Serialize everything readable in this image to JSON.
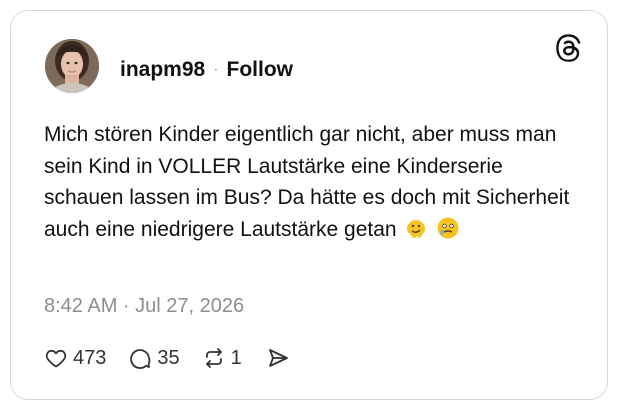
{
  "post": {
    "username": "inapm98",
    "separator": "·",
    "follow_label": "Follow",
    "text": "Mich stören Kinder eigentlich gar nicht, aber muss man sein Kind in VOLLER Lautstärke eine Kinderserie schauen lassen im Bus? Da hätte es doch mit Sicherheit auch eine niedrigere Lautstärke getan",
    "emojis": [
      "melting-face-emoji",
      "face-holding-back-tears-emoji"
    ],
    "timestamp": "8:42 AM · Jul 27, 2026",
    "likes": "473",
    "replies": "35",
    "reposts": "1"
  },
  "icons": {
    "logo": "threads-logo-icon",
    "like": "heart-icon",
    "reply": "speech-bubble-icon",
    "repost": "repost-icon",
    "share": "send-icon"
  },
  "colors": {
    "text": "#111111",
    "muted": "#8e8e8e",
    "border": "#d9d9d9",
    "emoji": "#f6c324"
  }
}
